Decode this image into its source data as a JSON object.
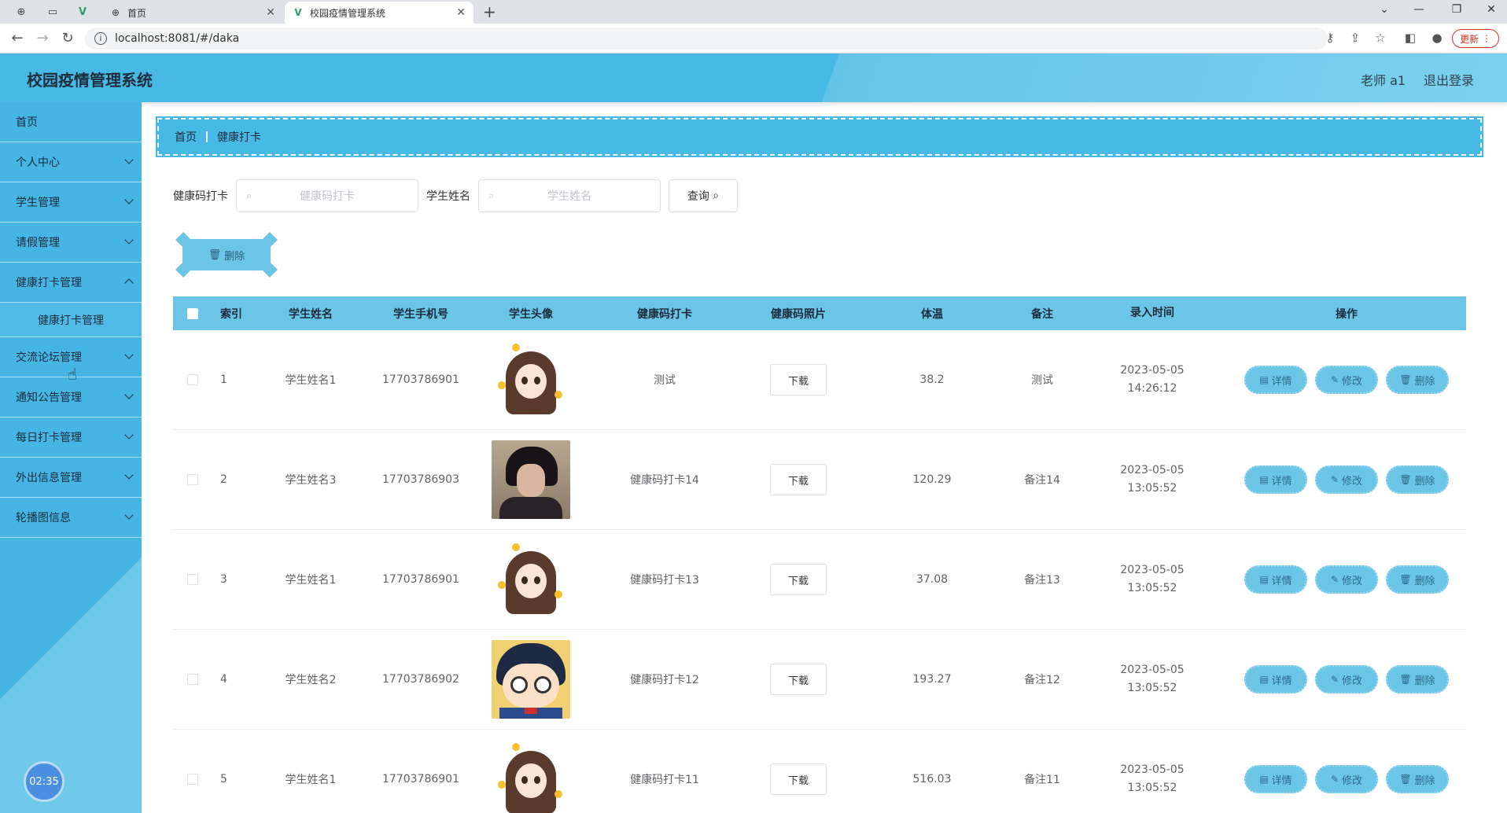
{
  "browser": {
    "tabs": [
      {
        "title": "首页"
      },
      {
        "title": "校园疫情管理系统"
      }
    ],
    "url": "localhost:8081/#/daka",
    "update_label": "更新"
  },
  "header": {
    "title": "校园疫情管理系统",
    "user": "老师 a1",
    "logout": "退出登录"
  },
  "sidebar": {
    "items": [
      {
        "label": "首页"
      },
      {
        "label": "个人中心"
      },
      {
        "label": "学生管理"
      },
      {
        "label": "请假管理"
      },
      {
        "label": "健康打卡管理"
      },
      {
        "label": "健康打卡管理"
      },
      {
        "label": "交流论坛管理"
      },
      {
        "label": "通知公告管理"
      },
      {
        "label": "每日打卡管理"
      },
      {
        "label": "外出信息管理"
      },
      {
        "label": "轮播图信息"
      }
    ],
    "clock": "02:35"
  },
  "breadcrumb": {
    "home": "首页",
    "current": "健康打卡"
  },
  "search": {
    "label1": "健康码打卡",
    "placeholder1": "健康码打卡",
    "label2": "学生姓名",
    "placeholder2": "学生姓名",
    "query": "查询"
  },
  "actions": {
    "delete": "删除"
  },
  "table": {
    "headers": [
      "索引",
      "学生姓名",
      "学生手机号",
      "学生头像",
      "健康码打卡",
      "健康码照片",
      "体温",
      "备注",
      "录入时间",
      "操作"
    ],
    "download": "下载",
    "ops": {
      "detail": "详情",
      "edit": "修改",
      "delete": "删除"
    },
    "rows": [
      {
        "index": "1",
        "name": "学生姓名1",
        "phone": "17703786901",
        "avatar": "girl",
        "code": "测试",
        "temp": "38.2",
        "note": "测试",
        "time": "2023-05-05 14:26:12"
      },
      {
        "index": "2",
        "name": "学生姓名3",
        "phone": "17703786903",
        "avatar": "boy",
        "code": "健康码打卡14",
        "temp": "120.29",
        "note": "备注14",
        "time": "2023-05-05 13:05:52"
      },
      {
        "index": "3",
        "name": "学生姓名1",
        "phone": "17703786901",
        "avatar": "girl",
        "code": "健康码打卡13",
        "temp": "37.08",
        "note": "备注13",
        "time": "2023-05-05 13:05:52"
      },
      {
        "index": "4",
        "name": "学生姓名2",
        "phone": "17703786902",
        "avatar": "conan",
        "code": "健康码打卡12",
        "temp": "193.27",
        "note": "备注12",
        "time": "2023-05-05 13:05:52"
      },
      {
        "index": "5",
        "name": "学生姓名1",
        "phone": "17703786901",
        "avatar": "girl",
        "code": "健康码打卡11",
        "temp": "516.03",
        "note": "备注11",
        "time": "2023-05-05 13:05:52"
      }
    ]
  }
}
